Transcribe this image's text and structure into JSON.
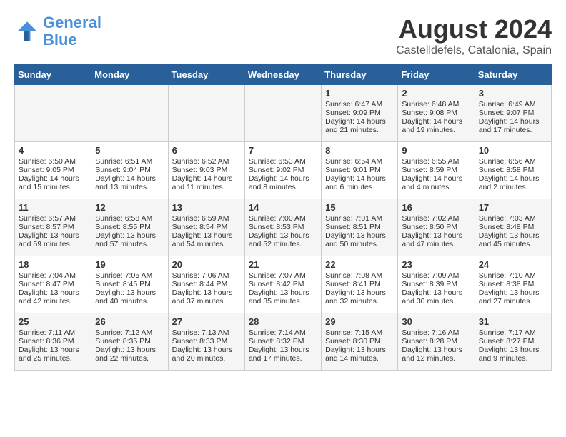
{
  "header": {
    "logo_line1": "General",
    "logo_line2": "Blue",
    "month": "August 2024",
    "location": "Castelldefels, Catalonia, Spain"
  },
  "weekdays": [
    "Sunday",
    "Monday",
    "Tuesday",
    "Wednesday",
    "Thursday",
    "Friday",
    "Saturday"
  ],
  "weeks": [
    [
      {
        "day": "",
        "info": ""
      },
      {
        "day": "",
        "info": ""
      },
      {
        "day": "",
        "info": ""
      },
      {
        "day": "",
        "info": ""
      },
      {
        "day": "1",
        "info": "Sunrise: 6:47 AM\nSunset: 9:09 PM\nDaylight: 14 hours and 21 minutes."
      },
      {
        "day": "2",
        "info": "Sunrise: 6:48 AM\nSunset: 9:08 PM\nDaylight: 14 hours and 19 minutes."
      },
      {
        "day": "3",
        "info": "Sunrise: 6:49 AM\nSunset: 9:07 PM\nDaylight: 14 hours and 17 minutes."
      }
    ],
    [
      {
        "day": "4",
        "info": "Sunrise: 6:50 AM\nSunset: 9:05 PM\nDaylight: 14 hours and 15 minutes."
      },
      {
        "day": "5",
        "info": "Sunrise: 6:51 AM\nSunset: 9:04 PM\nDaylight: 14 hours and 13 minutes."
      },
      {
        "day": "6",
        "info": "Sunrise: 6:52 AM\nSunset: 9:03 PM\nDaylight: 14 hours and 11 minutes."
      },
      {
        "day": "7",
        "info": "Sunrise: 6:53 AM\nSunset: 9:02 PM\nDaylight: 14 hours and 8 minutes."
      },
      {
        "day": "8",
        "info": "Sunrise: 6:54 AM\nSunset: 9:01 PM\nDaylight: 14 hours and 6 minutes."
      },
      {
        "day": "9",
        "info": "Sunrise: 6:55 AM\nSunset: 8:59 PM\nDaylight: 14 hours and 4 minutes."
      },
      {
        "day": "10",
        "info": "Sunrise: 6:56 AM\nSunset: 8:58 PM\nDaylight: 14 hours and 2 minutes."
      }
    ],
    [
      {
        "day": "11",
        "info": "Sunrise: 6:57 AM\nSunset: 8:57 PM\nDaylight: 13 hours and 59 minutes."
      },
      {
        "day": "12",
        "info": "Sunrise: 6:58 AM\nSunset: 8:55 PM\nDaylight: 13 hours and 57 minutes."
      },
      {
        "day": "13",
        "info": "Sunrise: 6:59 AM\nSunset: 8:54 PM\nDaylight: 13 hours and 54 minutes."
      },
      {
        "day": "14",
        "info": "Sunrise: 7:00 AM\nSunset: 8:53 PM\nDaylight: 13 hours and 52 minutes."
      },
      {
        "day": "15",
        "info": "Sunrise: 7:01 AM\nSunset: 8:51 PM\nDaylight: 13 hours and 50 minutes."
      },
      {
        "day": "16",
        "info": "Sunrise: 7:02 AM\nSunset: 8:50 PM\nDaylight: 13 hours and 47 minutes."
      },
      {
        "day": "17",
        "info": "Sunrise: 7:03 AM\nSunset: 8:48 PM\nDaylight: 13 hours and 45 minutes."
      }
    ],
    [
      {
        "day": "18",
        "info": "Sunrise: 7:04 AM\nSunset: 8:47 PM\nDaylight: 13 hours and 42 minutes."
      },
      {
        "day": "19",
        "info": "Sunrise: 7:05 AM\nSunset: 8:45 PM\nDaylight: 13 hours and 40 minutes."
      },
      {
        "day": "20",
        "info": "Sunrise: 7:06 AM\nSunset: 8:44 PM\nDaylight: 13 hours and 37 minutes."
      },
      {
        "day": "21",
        "info": "Sunrise: 7:07 AM\nSunset: 8:42 PM\nDaylight: 13 hours and 35 minutes."
      },
      {
        "day": "22",
        "info": "Sunrise: 7:08 AM\nSunset: 8:41 PM\nDaylight: 13 hours and 32 minutes."
      },
      {
        "day": "23",
        "info": "Sunrise: 7:09 AM\nSunset: 8:39 PM\nDaylight: 13 hours and 30 minutes."
      },
      {
        "day": "24",
        "info": "Sunrise: 7:10 AM\nSunset: 8:38 PM\nDaylight: 13 hours and 27 minutes."
      }
    ],
    [
      {
        "day": "25",
        "info": "Sunrise: 7:11 AM\nSunset: 8:36 PM\nDaylight: 13 hours and 25 minutes."
      },
      {
        "day": "26",
        "info": "Sunrise: 7:12 AM\nSunset: 8:35 PM\nDaylight: 13 hours and 22 minutes."
      },
      {
        "day": "27",
        "info": "Sunrise: 7:13 AM\nSunset: 8:33 PM\nDaylight: 13 hours and 20 minutes."
      },
      {
        "day": "28",
        "info": "Sunrise: 7:14 AM\nSunset: 8:32 PM\nDaylight: 13 hours and 17 minutes."
      },
      {
        "day": "29",
        "info": "Sunrise: 7:15 AM\nSunset: 8:30 PM\nDaylight: 13 hours and 14 minutes."
      },
      {
        "day": "30",
        "info": "Sunrise: 7:16 AM\nSunset: 8:28 PM\nDaylight: 13 hours and 12 minutes."
      },
      {
        "day": "31",
        "info": "Sunrise: 7:17 AM\nSunset: 8:27 PM\nDaylight: 13 hours and 9 minutes."
      }
    ]
  ]
}
